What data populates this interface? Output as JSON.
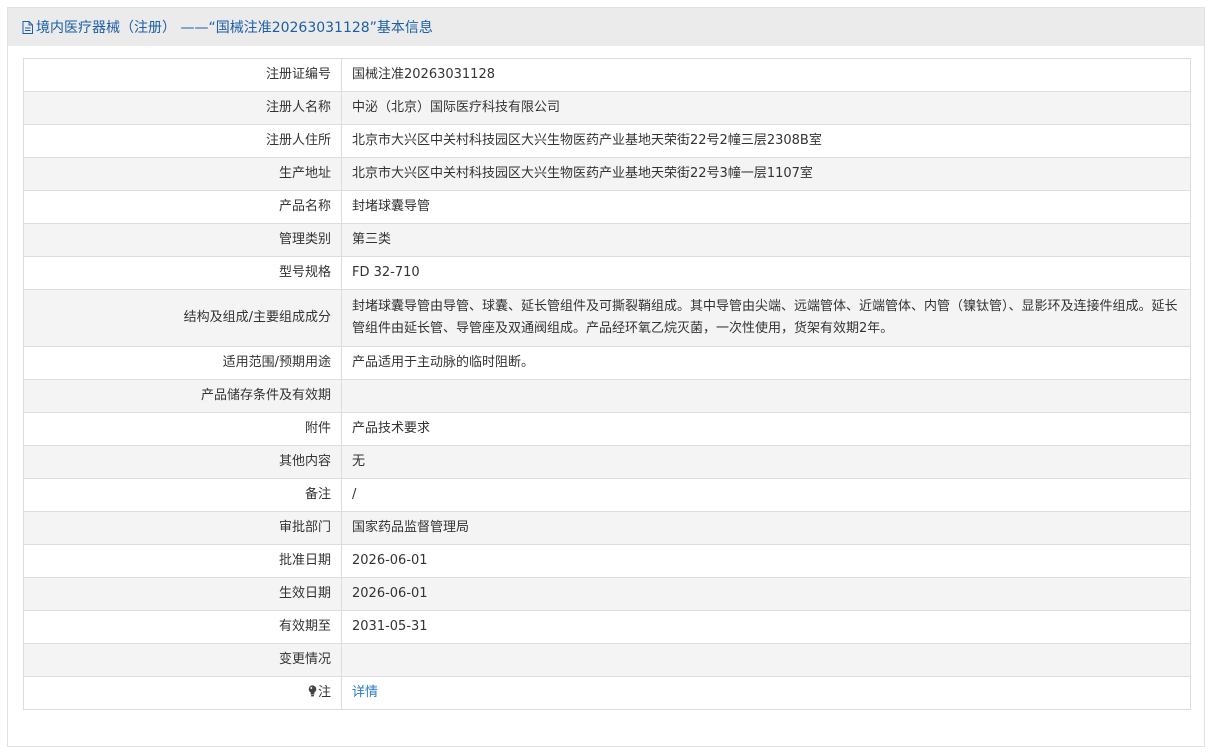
{
  "header": {
    "title": "境内医疗器械（注册） ——“国械注准20263031128”基本信息"
  },
  "rows": [
    {
      "label": "注册证编号",
      "value": "国械注准20263031128"
    },
    {
      "label": "注册人名称",
      "value": "中泌（北京）国际医疗科技有限公司"
    },
    {
      "label": "注册人住所",
      "value": "北京市大兴区中关村科技园区大兴生物医药产业基地天荣街22号2幢三层2308B室"
    },
    {
      "label": "生产地址",
      "value": "北京市大兴区中关村科技园区大兴生物医药产业基地天荣街22号3幢一层1107室"
    },
    {
      "label": "产品名称",
      "value": "封堵球囊导管"
    },
    {
      "label": "管理类别",
      "value": "第三类"
    },
    {
      "label": "型号规格",
      "value": "FD 32-710"
    },
    {
      "label": "结构及组成/主要组成成分",
      "value": "封堵球囊导管由导管、球囊、延长管组件及可撕裂鞘组成。其中导管由尖端、远端管体、近端管体、内管（镍钛管）、显影环及连接件组成。延长管组件由延长管、导管座及双通阀组成。产品经环氧乙烷灭菌，一次性使用，货架有效期2年。"
    },
    {
      "label": "适用范围/预期用途",
      "value": "产品适用于主动脉的临时阻断。"
    },
    {
      "label": "产品储存条件及有效期",
      "value": ""
    },
    {
      "label": "附件",
      "value": "产品技术要求"
    },
    {
      "label": "其他内容",
      "value": "无"
    },
    {
      "label": "备注",
      "value": "/"
    },
    {
      "label": "审批部门",
      "value": "国家药品监督管理局"
    },
    {
      "label": "批准日期",
      "value": "2026-06-01"
    },
    {
      "label": "生效日期",
      "value": "2026-06-01"
    },
    {
      "label": "有效期至",
      "value": "2031-05-31"
    },
    {
      "label": "变更情况",
      "value": ""
    }
  ],
  "note_row": {
    "label": "注",
    "icon": "lightbulb-icon",
    "link_text": "详情"
  }
}
